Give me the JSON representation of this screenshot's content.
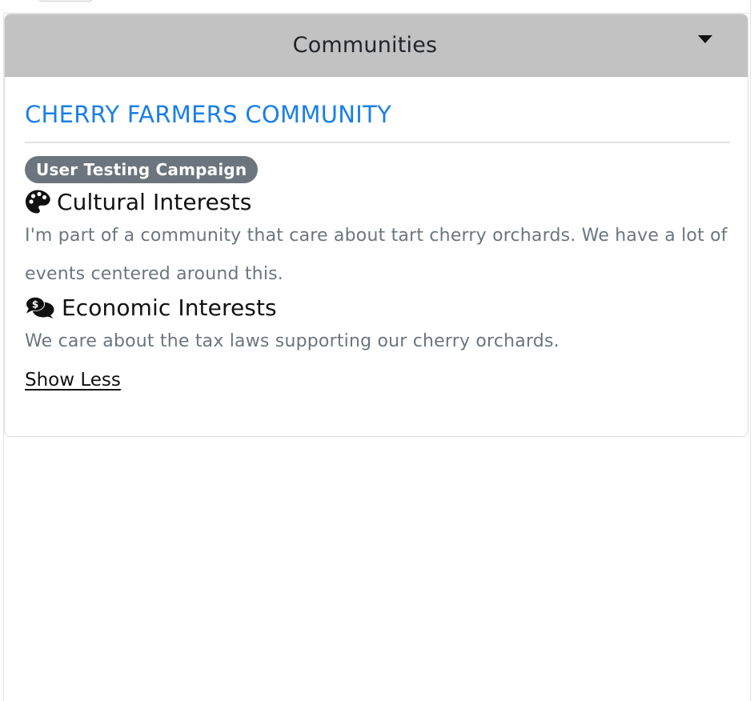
{
  "accordion": {
    "title": "Communities",
    "toggle_icon": "caret-down-icon"
  },
  "community": {
    "name": "CHERRY FARMERS COMMUNITY",
    "badge": "User Testing Campaign",
    "accent_color": "#1a7fe8",
    "badge_color": "#6c757d",
    "interests": [
      {
        "icon": "palette-icon",
        "heading": "Cultural Interests",
        "description": "I'm part of a community that care about tart cherry orchards. We have a lot of events centered around this."
      },
      {
        "icon": "comments-dollar-icon",
        "heading": "Economic Interests",
        "description": "We care about the tax laws supporting our cherry orchards."
      }
    ],
    "toggle_label": "Show Less"
  }
}
